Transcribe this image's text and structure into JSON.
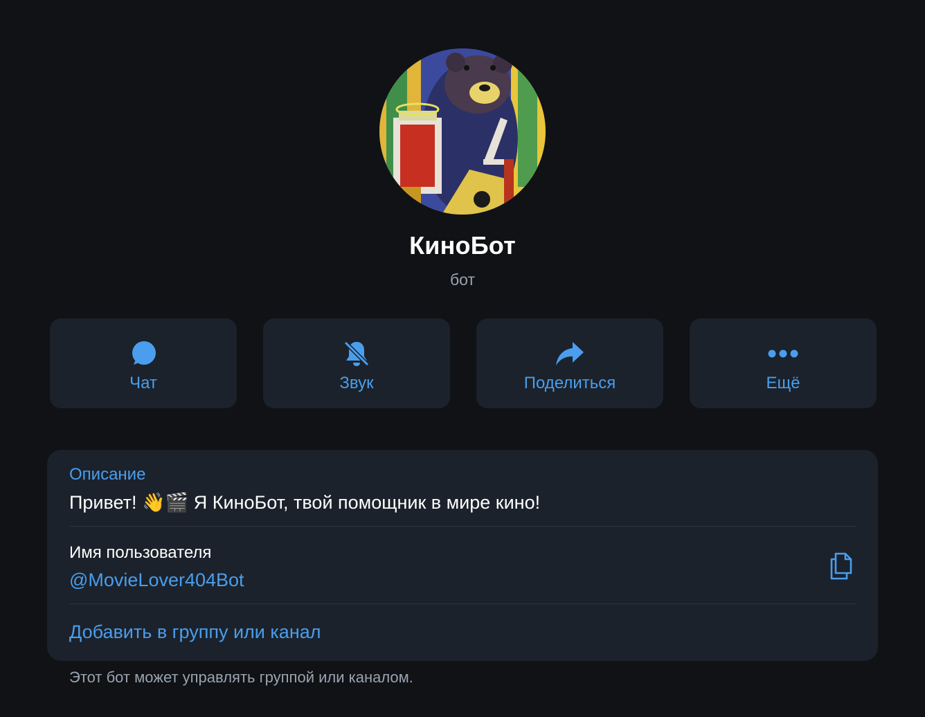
{
  "profile": {
    "name": "КиноБот",
    "type_label": "бот",
    "avatar_icon": "bear-painting-avatar"
  },
  "actions": [
    {
      "label": "Чат",
      "icon": "chat-bubble-icon"
    },
    {
      "label": "Звук",
      "icon": "bell-muted-icon"
    },
    {
      "label": "Поделиться",
      "icon": "share-arrow-icon"
    },
    {
      "label": "Ещё",
      "icon": "more-dots-icon"
    }
  ],
  "info": {
    "description_label": "Описание",
    "description_text": "Привет! 👋🎬 Я КиноБот, твой помощник в мире кино!",
    "username_label": "Имя пользователя",
    "username_value": "@MovieLover404Bot",
    "copy_icon": "copy-icon",
    "add_link": "Добавить в группу или канал"
  },
  "footnote": "Этот бот может управлять группой или каналом.",
  "colors": {
    "background": "#101215",
    "card": "#1b222b",
    "accent": "#4a9eed",
    "muted": "#9aa4b0"
  }
}
